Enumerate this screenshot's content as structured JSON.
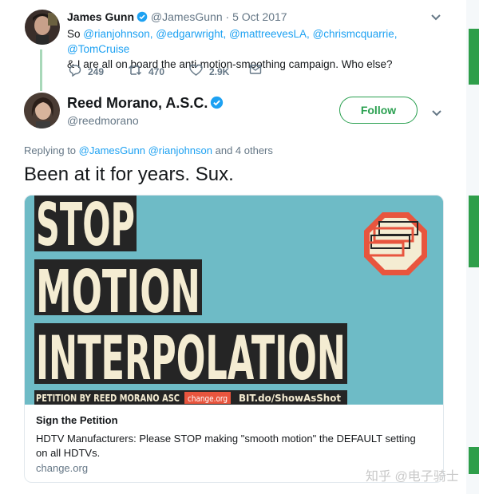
{
  "tweet1": {
    "author_name": "James Gunn",
    "handle": "@JamesGunn",
    "separator": "·",
    "date": "5 Oct 2017",
    "text_prefix": "So ",
    "mentions": [
      "@rianjohnson,",
      "@edgarwright,",
      "@mattreevesLA,",
      "@chrismcquarrie,",
      "@TomCruise"
    ],
    "text_rest": "& I are all on board the anti-motion-smoothing campaign. Who else?",
    "reply_count": "249",
    "retweet_count": "470",
    "like_count": "2.9K"
  },
  "tweet2": {
    "author_name": "Reed Morano, A.S.C.",
    "handle": "@reedmorano",
    "follow_label": "Follow",
    "replying_label": "Replying to",
    "replying_mentions": "@JamesGunn @rianjohnson",
    "replying_suffix": "and 4 others",
    "text": "Been at it for years. Sux."
  },
  "card": {
    "image_line1": "STOP",
    "image_line2": "MOTION",
    "image_line3": "INTERPOLATION",
    "footer_petition": "PETITION BY REED MORANO ASC",
    "footer_site": "change.org",
    "footer_link": "BIT.do/ShowAsShot",
    "title": "Sign the Petition",
    "description": "HDTV Manufacturers: Please STOP making \"smooth motion\" the DEFAULT setting on all HDTVs.",
    "domain": "change.org"
  },
  "watermark": "知乎 @电子骑士",
  "colors": {
    "link": "#1da1f2",
    "follow_green": "#2aa050",
    "muted": "#657786",
    "card_bg": "#6ebbc6",
    "stop_sign": "#e8553e",
    "banner_dark": "#252525",
    "banner_text": "#f4ecd2"
  },
  "icons": [
    "verified-badge-icon",
    "reply-icon",
    "retweet-icon",
    "like-icon",
    "message-icon",
    "chevron-down-icon",
    "stop-sign-icon"
  ]
}
